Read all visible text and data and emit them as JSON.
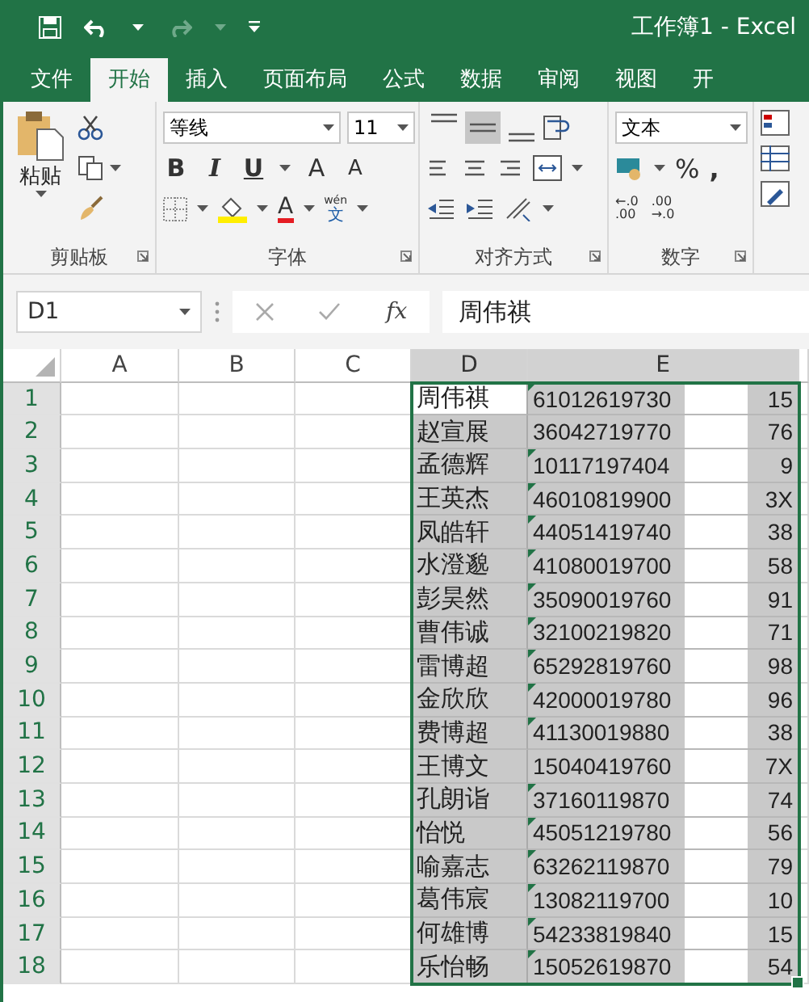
{
  "window": {
    "title": "工作簿1 - Excel"
  },
  "tabs": [
    {
      "label": "文件",
      "selected": false
    },
    {
      "label": "开始",
      "selected": true
    },
    {
      "label": "插入",
      "selected": false
    },
    {
      "label": "页面布局",
      "selected": false
    },
    {
      "label": "公式",
      "selected": false
    },
    {
      "label": "数据",
      "selected": false
    },
    {
      "label": "审阅",
      "selected": false
    },
    {
      "label": "视图",
      "selected": false
    },
    {
      "label": "开",
      "selected": false
    }
  ],
  "ribbon": {
    "clipboard": {
      "paste": "粘贴",
      "label": "剪贴板"
    },
    "font": {
      "name": "等线",
      "size": "11",
      "bold": "B",
      "italic": "I",
      "underline": "U",
      "grow": "A",
      "shrink": "A",
      "font_color": "A",
      "phonetic_top": "wén",
      "phonetic": "文",
      "label": "字体"
    },
    "alignment": {
      "vertical": [
        {
          "selected": false
        },
        {
          "selected": true
        },
        {
          "selected": false
        }
      ],
      "label": "对齐方式"
    },
    "number": {
      "format": "文本",
      "percent": "%",
      "comma": ",",
      "increase_decimal": [
        "←.0",
        ".00"
      ],
      "decrease_decimal": [
        ".00",
        "→.0"
      ],
      "label": "数字"
    }
  },
  "formula_bar": {
    "name_box": "D1",
    "fx": "fx",
    "formula": "周伟祺"
  },
  "sheet": {
    "columns": [
      {
        "label": "A",
        "selected": false
      },
      {
        "label": "B",
        "selected": false
      },
      {
        "label": "C",
        "selected": false
      },
      {
        "label": "D",
        "selected": true
      },
      {
        "label": "E",
        "selected": true
      }
    ],
    "rows": [
      {
        "number": "1",
        "name": "周伟祺",
        "id_start": "61012619730",
        "id_end": "15",
        "warning": true,
        "selected": true,
        "active": true
      },
      {
        "number": "2",
        "name": "赵宣展",
        "id_start": "36042719770",
        "id_end": "76",
        "warning": false,
        "selected": true,
        "active": false
      },
      {
        "number": "3",
        "name": "孟德辉",
        "id_start": "10117197404",
        "id_end": "9",
        "warning": true,
        "selected": true,
        "active": false
      },
      {
        "number": "4",
        "name": "王英杰",
        "id_start": "46010819900",
        "id_end": "3X",
        "warning": true,
        "selected": true,
        "active": false
      },
      {
        "number": "5",
        "name": "凤皓轩",
        "id_start": "44051419740",
        "id_end": "38",
        "warning": true,
        "selected": true,
        "active": false
      },
      {
        "number": "6",
        "name": "水澄邈",
        "id_start": "41080019700",
        "id_end": "58",
        "warning": true,
        "selected": true,
        "active": false
      },
      {
        "number": "7",
        "name": "彭昊然",
        "id_start": "35090019760",
        "id_end": "91",
        "warning": true,
        "selected": true,
        "active": false
      },
      {
        "number": "8",
        "name": "曹伟诚",
        "id_start": "32100219820",
        "id_end": "71",
        "warning": true,
        "selected": true,
        "active": false
      },
      {
        "number": "9",
        "name": "雷博超",
        "id_start": "65292819760",
        "id_end": "98",
        "warning": true,
        "selected": true,
        "active": false
      },
      {
        "number": "10",
        "name": "金欣欣",
        "id_start": "42000019780",
        "id_end": "96",
        "warning": true,
        "selected": true,
        "active": false
      },
      {
        "number": "11",
        "name": "费博超",
        "id_start": "41130019880",
        "id_end": "38",
        "warning": true,
        "selected": true,
        "active": false
      },
      {
        "number": "12",
        "name": "王博文",
        "id_start": "15040419760",
        "id_end": "7X",
        "warning": false,
        "selected": true,
        "active": false
      },
      {
        "number": "13",
        "name": "孔朗诣",
        "id_start": "37160119870",
        "id_end": "74",
        "warning": true,
        "selected": true,
        "active": false
      },
      {
        "number": "14",
        "name": "怡悦",
        "id_start": "45051219780",
        "id_end": "56",
        "warning": true,
        "selected": true,
        "active": false
      },
      {
        "number": "15",
        "name": "喻嘉志",
        "id_start": "63262119870",
        "id_end": "79",
        "warning": true,
        "selected": true,
        "active": false
      },
      {
        "number": "16",
        "name": "葛伟宸",
        "id_start": "13082119700",
        "id_end": "10",
        "warning": true,
        "selected": true,
        "active": false
      },
      {
        "number": "17",
        "name": "何雄博",
        "id_start": "54233819840",
        "id_end": "15",
        "warning": true,
        "selected": true,
        "active": false
      },
      {
        "number": "18",
        "name": "乐怡畅",
        "id_start": "15052619870",
        "id_end": "54",
        "warning": true,
        "selected": true,
        "active": false
      }
    ]
  }
}
